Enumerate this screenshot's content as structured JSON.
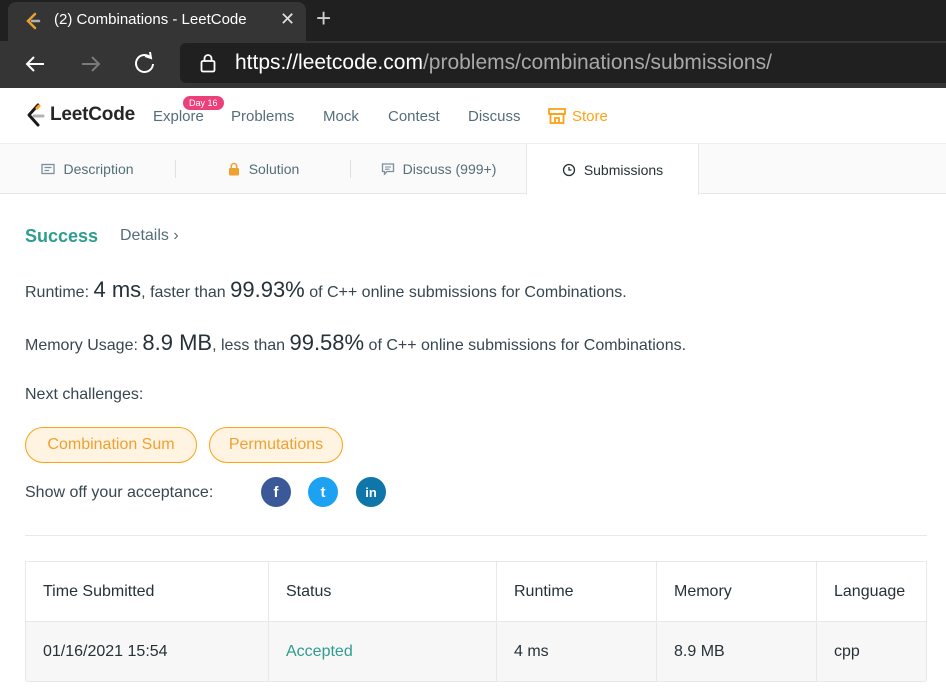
{
  "browser": {
    "tab_title": "(2) Combinations - LeetCode",
    "tab_close": "✕",
    "new_tab": "+",
    "url_host": "https://leetcode.com",
    "url_path": "/problems/combinations/submissions/"
  },
  "nav": {
    "brand": "LeetCode",
    "badge": "Day 16",
    "links": [
      "Explore",
      "Problems",
      "Mock",
      "Contest",
      "Discuss",
      "Store"
    ],
    "accent": "#ffa116"
  },
  "subtabs": [
    "Description",
    "Solution",
    "Discuss (999+)",
    "Submissions"
  ],
  "result": {
    "status": "Success",
    "details": "Details",
    "details_chevron": "›",
    "runtime_label": "Runtime:",
    "runtime_value": "4 ms",
    "runtime_mid": ", faster than",
    "runtime_pct": "99.93%",
    "runtime_tail": "of C++ online submissions for Combinations.",
    "memory_label": "Memory Usage:",
    "memory_value": "8.9 MB",
    "memory_mid": ", less than",
    "memory_pct": "99.58%",
    "memory_tail": "of C++ online submissions for Combinations.",
    "next_label": "Next challenges:",
    "challenges": [
      "Combination Sum",
      "Permutations"
    ],
    "share_label": "Show off your acceptance:",
    "social": [
      "facebook-icon",
      "twitter-icon",
      "linkedin-icon"
    ],
    "social_glyphs": [
      "f",
      "t",
      "in"
    ]
  },
  "table": {
    "headers": [
      "Time Submitted",
      "Status",
      "Runtime",
      "Memory",
      "Language"
    ],
    "rows": [
      [
        "01/16/2021 15:54",
        "Accepted",
        "4 ms",
        "8.9 MB",
        "cpp"
      ]
    ]
  }
}
